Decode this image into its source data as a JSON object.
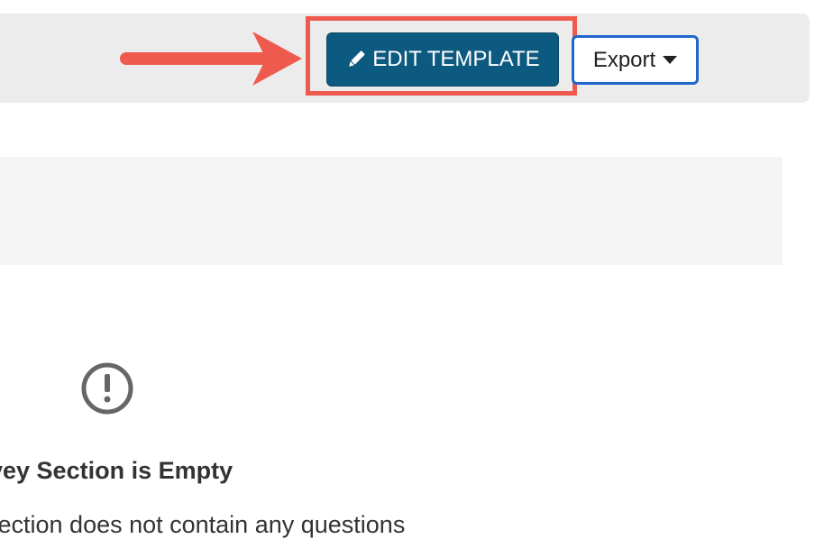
{
  "toolbar": {
    "edit_template_label": "EDIT TEMPLATE",
    "export_label": "Export"
  },
  "annotation": {
    "highlight_color": "#ef5a4f",
    "arrow_color": "#ef5a4f"
  },
  "icons": {
    "edit": "pencil-icon",
    "export_dropdown": "caret-down-icon",
    "empty_state": "exclamation-circle-icon"
  },
  "empty_state": {
    "title": "vey Section is Empty",
    "description": "section does not contain any questions"
  },
  "colors": {
    "primary_button": "#0d5a80",
    "export_border": "#2266cc",
    "toolbar_bg": "#ececec",
    "panel_bg": "#f5f5f5"
  }
}
